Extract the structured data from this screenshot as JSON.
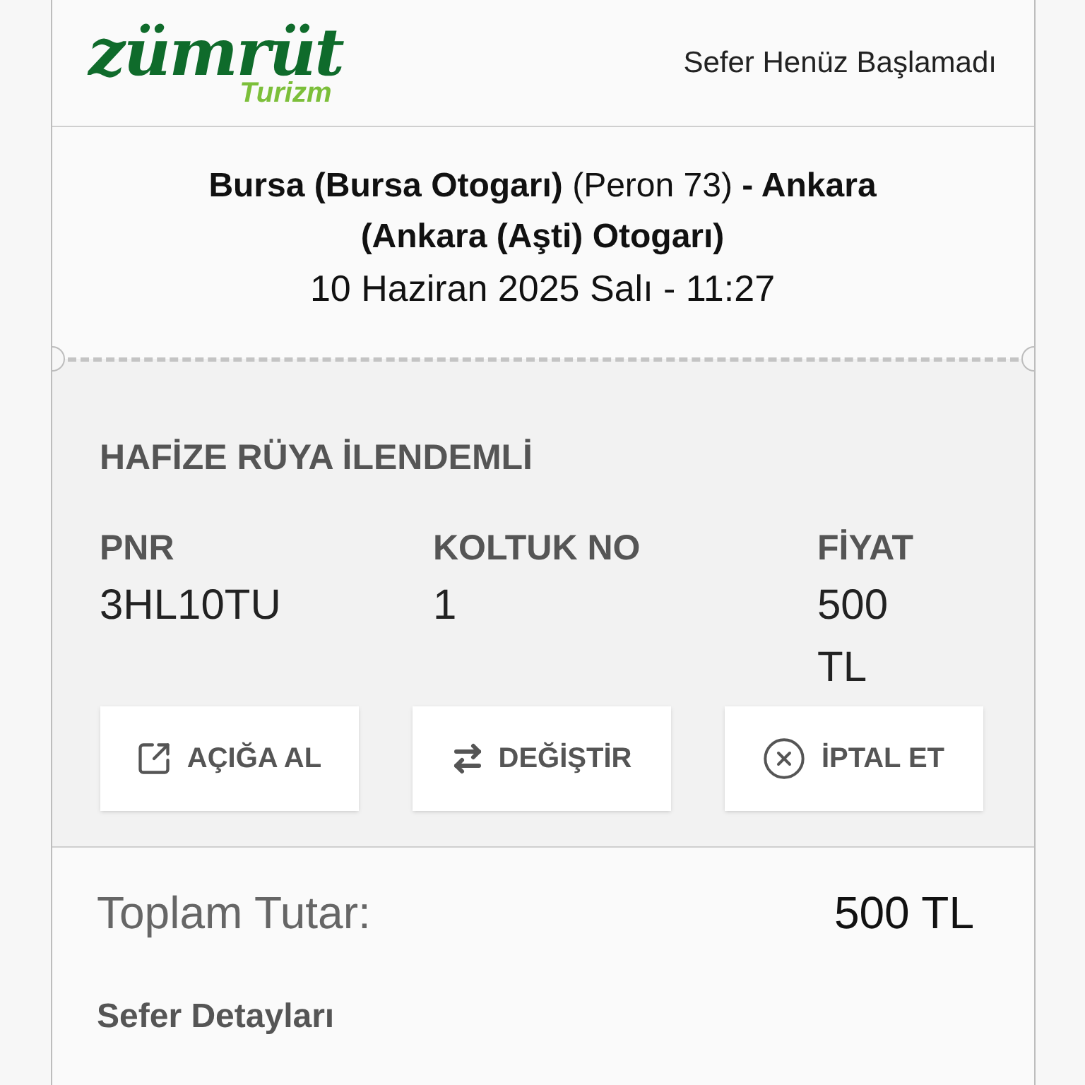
{
  "logo": {
    "name": "zümrüt",
    "subtitle": "Turizm"
  },
  "status": "Sefer Henüz Başlamadı",
  "route": "**Bursa (Bursa Otogarı)** (Peron 73) **- Ankara (Ankara (Aşti) Otogarı)**",
  "date": "10 Haziran 2025 Salı - 11:27",
  "passenger": {
    "name": "HAFİZE RÜYA İLENDEMLİ",
    "fields": [
      {
        "label": "PNR",
        "value": "3HL10TU"
      },
      {
        "label": "KOLTUK NO",
        "value": "1"
      },
      {
        "label": "FİYAT",
        "value": "500 TL"
      }
    ]
  },
  "actions": [
    {
      "kind": "external",
      "label": "AÇIĞA AL"
    },
    {
      "kind": "swap",
      "label": "DEĞİŞTİR"
    },
    {
      "kind": "cancel",
      "label": "İPTAL ET"
    }
  ],
  "total": {
    "label": "Toplam Tutar:",
    "value": "500 TL"
  },
  "details_heading": "Sefer Detayları"
}
